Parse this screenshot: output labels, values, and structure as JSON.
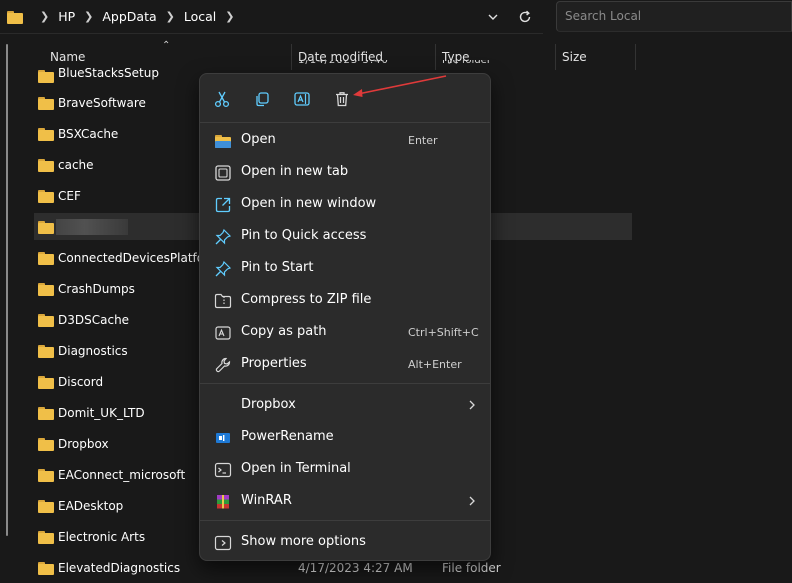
{
  "address_bar": {
    "crumbs": [
      "HP",
      "AppData",
      "Local"
    ],
    "search_placeholder": "Search Local"
  },
  "columns": [
    "Name",
    "Date modified",
    "Type",
    "Size"
  ],
  "rows": [
    {
      "name": "BlueStacksSetup",
      "date": "",
      "type": ""
    },
    {
      "name": "BraveSoftware",
      "date": "",
      "type": ""
    },
    {
      "name": "BSXCache",
      "date": "",
      "type": ""
    },
    {
      "name": "cache",
      "date": "",
      "type": ""
    },
    {
      "name": "CEF",
      "date": "",
      "type": ""
    },
    {
      "name": "",
      "date": "",
      "type": "",
      "selected": true
    },
    {
      "name": "ConnectedDevicesPlatform",
      "date": "",
      "type": ""
    },
    {
      "name": "CrashDumps",
      "date": "",
      "type": ""
    },
    {
      "name": "D3DSCache",
      "date": "",
      "type": ""
    },
    {
      "name": "Diagnostics",
      "date": "",
      "type": ""
    },
    {
      "name": "Discord",
      "date": "",
      "type": ""
    },
    {
      "name": "Domit_UK_LTD",
      "date": "",
      "type": ""
    },
    {
      "name": "Dropbox",
      "date": "",
      "type": ""
    },
    {
      "name": "EAConnect_microsoft",
      "date": "",
      "type": ""
    },
    {
      "name": "EADesktop",
      "date": "",
      "type": ""
    },
    {
      "name": "Electronic Arts",
      "date": "",
      "type": ""
    },
    {
      "name": "ElevatedDiagnostics",
      "date": "4/17/2023 4:27 AM",
      "type": "File folder"
    }
  ],
  "context_menu": {
    "quick_actions": [
      {
        "icon": "scissors-icon"
      },
      {
        "icon": "copy-icon"
      },
      {
        "icon": "rename-icon"
      },
      {
        "icon": "trash-icon"
      }
    ],
    "items": [
      {
        "label": "Open",
        "shortcut": "Enter",
        "icon": "folder-open-icon"
      },
      {
        "label": "Open in new tab",
        "shortcut": "",
        "icon": "new-tab-icon"
      },
      {
        "label": "Open in new window",
        "shortcut": "",
        "icon": "new-window-icon"
      },
      {
        "label": "Pin to Quick access",
        "shortcut": "",
        "icon": "pin-icon"
      },
      {
        "label": "Pin to Start",
        "shortcut": "",
        "icon": "pin-icon"
      },
      {
        "label": "Compress to ZIP file",
        "shortcut": "",
        "icon": "zip-icon"
      },
      {
        "label": "Copy as path",
        "shortcut": "Ctrl+Shift+C",
        "icon": "copy-path-icon"
      },
      {
        "label": "Properties",
        "shortcut": "Alt+Enter",
        "icon": "wrench-icon"
      },
      {
        "label": "Dropbox",
        "shortcut": "",
        "icon": "",
        "submenu": true
      },
      {
        "label": "PowerRename",
        "shortcut": "",
        "icon": "powerrename-icon"
      },
      {
        "label": "Open in Terminal",
        "shortcut": "",
        "icon": "terminal-icon"
      },
      {
        "label": "WinRAR",
        "shortcut": "",
        "icon": "winrar-icon",
        "submenu": true
      },
      {
        "label": "Show more options",
        "shortcut": "",
        "icon": "more-options-icon"
      }
    ]
  },
  "colors": {
    "background": "#191919",
    "menu_background": "#2b2b2b",
    "folder": "#f0bf48",
    "accent": "#60cdff",
    "annotation": "#e03a3a"
  }
}
